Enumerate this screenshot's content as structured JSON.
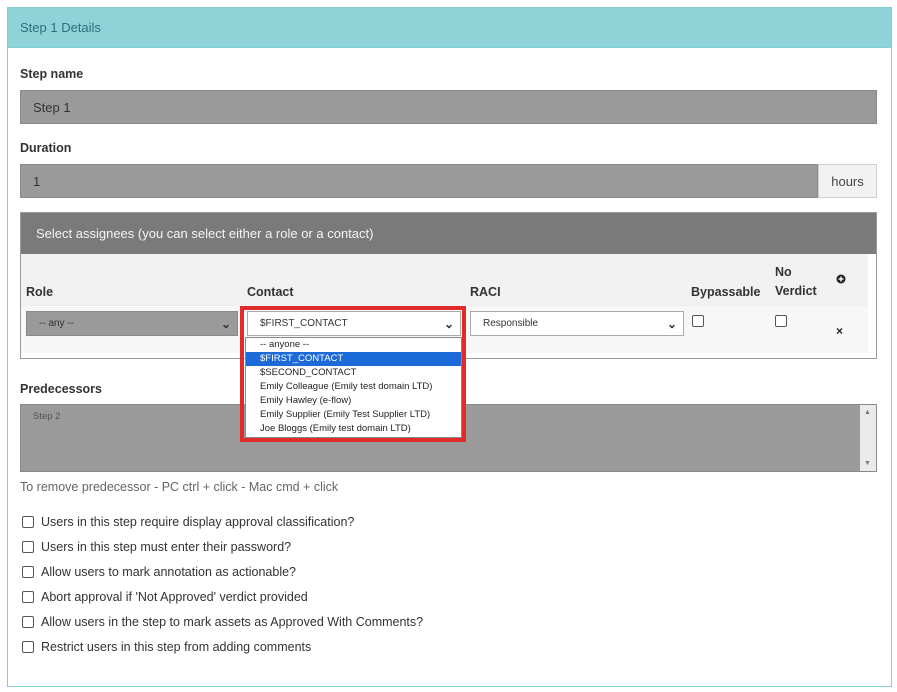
{
  "panel": {
    "title": "Step 1 Details"
  },
  "step_name": {
    "label": "Step name",
    "value": "Step 1"
  },
  "duration": {
    "label": "Duration",
    "value": "1",
    "unit": "hours"
  },
  "assignees": {
    "header": "Select assignees (you can select either a role or a contact)",
    "columns": {
      "role": "Role",
      "contact": "Contact",
      "raci": "RACI",
      "bypassable": "Bypassable",
      "no_verdict_1": "No",
      "no_verdict_2": "Verdict"
    },
    "row": {
      "role": "-- any --",
      "contact": "$FIRST_CONTACT",
      "raci": "Responsible"
    },
    "contact_options": [
      "-- anyone --",
      "$FIRST_CONTACT",
      "$SECOND_CONTACT",
      "Emily Colleague (Emily test domain LTD)",
      "Emily Hawley (e-flow)",
      "Emily Supplier (Emily Test Supplier LTD)",
      "Joe Bloggs (Emily test domain LTD)"
    ],
    "selected_option_index": 1
  },
  "predecessors": {
    "label": "Predecessors",
    "placeholder": "Step 2",
    "hint": "To remove predecessor - PC ctrl + click - Mac cmd + click"
  },
  "options": [
    "Users in this step require display approval classification?",
    "Users in this step must enter their password?",
    "Allow users to mark annotation as actionable?",
    "Abort approval if 'Not Approved' verdict provided",
    "Allow users in the step to mark assets as Approved With Comments?",
    "Restrict users in this step from adding comments"
  ],
  "colors": {
    "header_bg": "#8fd3d8",
    "highlight": "#e02b2b",
    "selected": "#1c6ad8"
  }
}
